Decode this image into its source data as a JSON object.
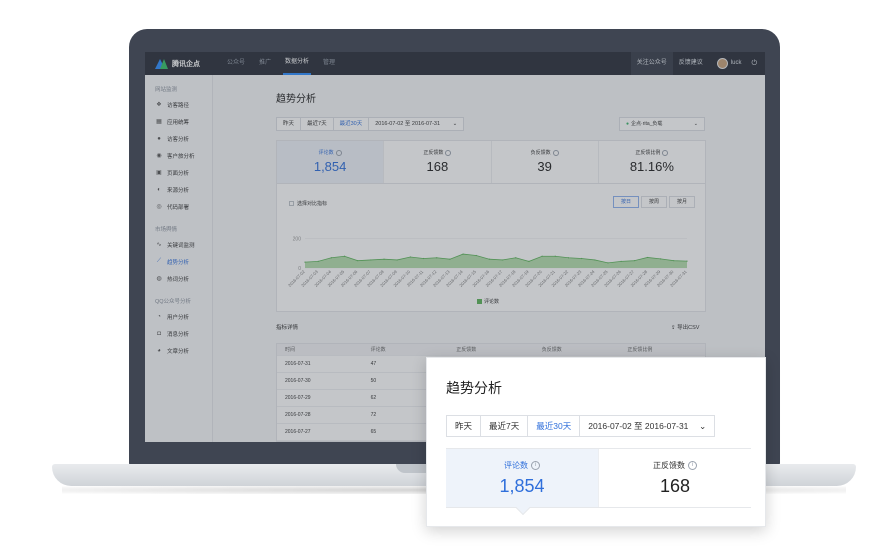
{
  "nav": {
    "brand": "腾讯企点",
    "items": [
      "公众号",
      "推广",
      "数据分析",
      "管理"
    ],
    "active_index": 2,
    "right": {
      "follow": "关注公众号",
      "feedback": "反馈建议",
      "username": "luck"
    }
  },
  "sidebar": {
    "groups": [
      {
        "title": "网站监测",
        "items": [
          {
            "label": "访客路径",
            "icon": "path-icon"
          },
          {
            "label": "应用统筹",
            "icon": "app-icon"
          },
          {
            "label": "访客分析",
            "icon": "user-icon"
          },
          {
            "label": "客户旅分析",
            "icon": "eye-icon"
          },
          {
            "label": "页面分析",
            "icon": "page-icon"
          },
          {
            "label": "来源分析",
            "icon": "source-icon"
          },
          {
            "label": "代码部署",
            "icon": "code-icon"
          }
        ]
      },
      {
        "title": "市场舆情",
        "items": [
          {
            "label": "关键词监测",
            "icon": "pulse-icon"
          },
          {
            "label": "趋势分析",
            "icon": "trend-icon",
            "active": true
          },
          {
            "label": "热词分析",
            "icon": "hotword-icon"
          }
        ]
      },
      {
        "title": "QQ公众号分析",
        "items": [
          {
            "label": "用户分析",
            "icon": "fan-icon"
          },
          {
            "label": "消息分析",
            "icon": "message-icon"
          },
          {
            "label": "文章分析",
            "icon": "article-icon"
          }
        ]
      }
    ]
  },
  "page": {
    "title": "趋势分析",
    "range_buttons": [
      "昨天",
      "最近7天",
      "最近30天"
    ],
    "active_range": 2,
    "date_range": "2016-07-02 至 2016-07-31",
    "business_select": "企点·rita_负载",
    "stats": [
      {
        "label": "评论数",
        "value": "1,854",
        "active": true
      },
      {
        "label": "正反馈数",
        "value": "168"
      },
      {
        "label": "负反馈数",
        "value": "39"
      },
      {
        "label": "正反馈比例",
        "value": "81.16%"
      }
    ],
    "compare_label": "选择对比指标",
    "granularity": [
      "按日",
      "按周",
      "按月"
    ],
    "active_granularity": 0,
    "legend": "评论数",
    "detail_title": "指标详情",
    "export_label": "导出CSV",
    "table": {
      "headers": [
        "时间",
        "评论数",
        "正反馈数",
        "负反馈数",
        "正反馈比例"
      ],
      "rows": [
        [
          "2016-07-31",
          "47"
        ],
        [
          "2016-07-30",
          "50"
        ],
        [
          "2016-07-29",
          "62"
        ],
        [
          "2016-07-28",
          "72"
        ],
        [
          "2016-07-27",
          "65"
        ]
      ]
    }
  },
  "chart_data": {
    "type": "area",
    "title": "",
    "xlabel": "",
    "ylabel": "",
    "ylim": [
      0,
      300
    ],
    "yticks": [
      "200",
      "0"
    ],
    "x": [
      "2016-07-02",
      "2016-07-03",
      "2016-07-04",
      "2016-07-05",
      "2016-07-06",
      "2016-07-07",
      "2016-07-08",
      "2016-07-09",
      "2016-07-10",
      "2016-07-11",
      "2016-07-12",
      "2016-07-13",
      "2016-07-14",
      "2016-07-15",
      "2016-07-16",
      "2016-07-17",
      "2016-07-18",
      "2016-07-19",
      "2016-07-20",
      "2016-07-21",
      "2016-07-22",
      "2016-07-23",
      "2016-07-24",
      "2016-07-25",
      "2016-07-26",
      "2016-07-27",
      "2016-07-28",
      "2016-07-29",
      "2016-07-30",
      "2016-07-31"
    ],
    "series": [
      {
        "name": "评论数",
        "values": [
          40,
          45,
          70,
          80,
          50,
          55,
          60,
          55,
          75,
          65,
          70,
          60,
          95,
          85,
          60,
          55,
          70,
          45,
          80,
          80,
          70,
          65,
          55,
          35,
          45,
          50,
          72,
          62,
          50,
          47
        ]
      }
    ],
    "colors": {
      "fill": "#a8d8a0",
      "stroke": "#5db55b"
    }
  },
  "zoom": {
    "title": "趋势分析",
    "range_buttons": [
      "昨天",
      "最近7天",
      "最近30天"
    ],
    "active_range": 2,
    "date_range": "2016-07-02 至 2016-07-31",
    "stats": [
      {
        "label": "评论数",
        "value": "1,854",
        "active": true
      },
      {
        "label": "正反馈数",
        "value": "168"
      }
    ]
  }
}
